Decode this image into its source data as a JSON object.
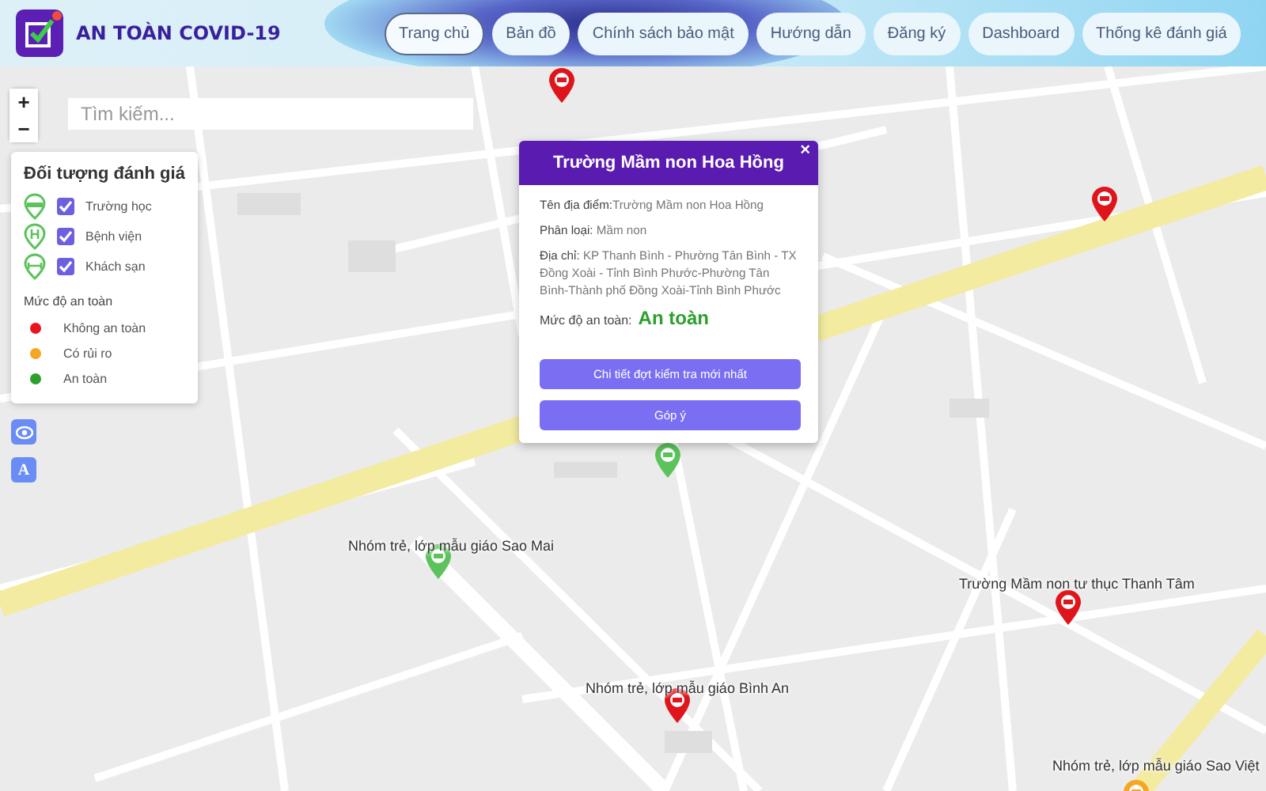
{
  "header": {
    "title": "AN TOÀN COVID-19",
    "nav": [
      {
        "label": "Trang chủ",
        "selected": true
      },
      {
        "label": "Bản đồ",
        "selected": false
      },
      {
        "label": "Chính sách bảo mật",
        "selected": false
      },
      {
        "label": "Hướng dẫn",
        "selected": false
      },
      {
        "label": "Đăng ký",
        "selected": false
      },
      {
        "label": "Dashboard",
        "selected": false
      },
      {
        "label": "Thống kê đánh giá",
        "selected": false
      }
    ]
  },
  "map": {
    "zoom_in": "+",
    "zoom_out": "−",
    "search": {
      "placeholder": "Tìm kiếm..."
    },
    "legend": {
      "title": "Đối tượng đánh giá",
      "objects": [
        {
          "label": "Trường học",
          "checked": true,
          "kind": "school"
        },
        {
          "label": "Bệnh viện",
          "checked": true,
          "kind": "hospital"
        },
        {
          "label": "Khách sạn",
          "checked": true,
          "kind": "hotel"
        }
      ],
      "levels_title": "Mức độ an toàn",
      "levels": [
        {
          "label": "Không an toàn",
          "color": "#e8141b"
        },
        {
          "label": "Có rủi ro",
          "color": "#f5a623"
        },
        {
          "label": "An toàn",
          "color": "#2ca02c"
        }
      ]
    },
    "tools": [
      {
        "kind": "locate"
      },
      {
        "kind": "letter",
        "text": "A"
      }
    ],
    "markers": [
      {
        "color": "#e0141b"
      },
      {
        "color": "#e0141b"
      },
      {
        "color": "#5cc35c"
      },
      {
        "label": "Nhóm trẻ, lớp mẫu giáo Sao Mai",
        "color": "#5cc35c"
      },
      {
        "label": "Trường Mầm non tư thục Thanh Tâm",
        "color": "#e0141b"
      },
      {
        "label": "Nhóm trẻ, lớp mẫu giáo Bình An",
        "color": "#e0141b"
      },
      {
        "label": "Nhóm trẻ, lớp mẫu giáo Sao Việt",
        "color": "#f5a623"
      }
    ],
    "popup": {
      "title": "Trường Mầm non Hoa Hồng",
      "fields": [
        {
          "label": "Tên địa điểm:",
          "value": "Trường Mầm non Hoa Hồng"
        },
        {
          "label": "Phân loại:",
          "value": "Mầm non"
        },
        {
          "label": "Địa chỉ:",
          "value": "KP Thanh Bình - Phường Tân Bình - TX Đồng Xoài - Tỉnh Bình Phước-Phường Tân Bình-Thành phố Đồng Xoài-Tỉnh Bình Phước"
        }
      ],
      "safety_label": "Mức độ an toàn:",
      "safety_value": "An toàn",
      "buttons": [
        "Chi tiết đợt kiểm tra mới nhất",
        "Góp ý"
      ],
      "close": "×"
    }
  }
}
